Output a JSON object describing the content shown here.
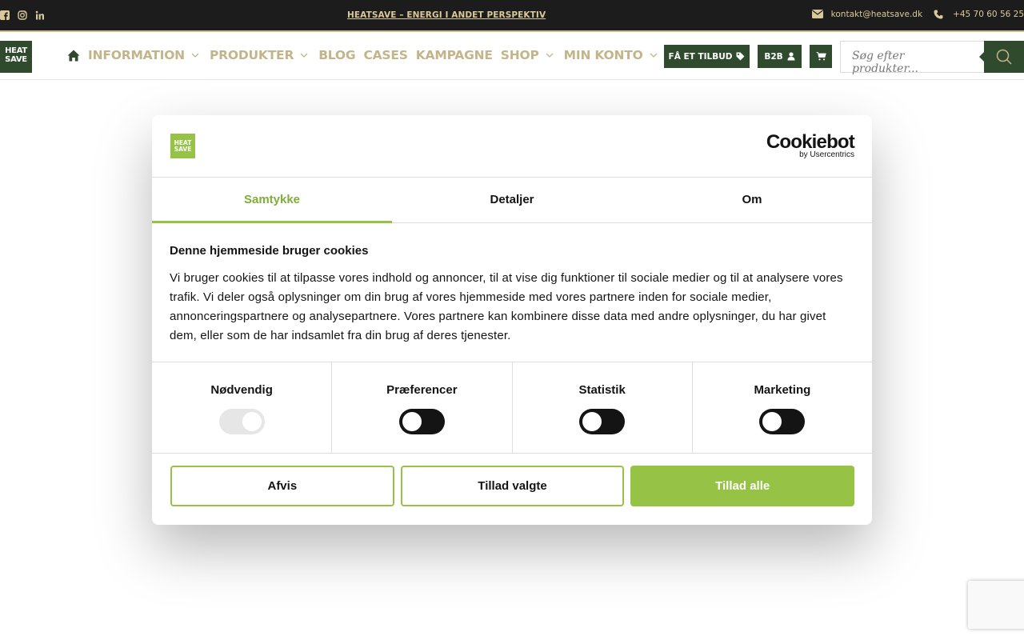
{
  "topbar": {
    "announcement": "HEATSAVE – ENERGI I ANDET PERSPEKTIV",
    "email": "kontakt@heatsave.dk",
    "phone": "+45 70 60 56 25",
    "social_icons": [
      "facebook-icon",
      "instagram-icon",
      "linkedin-icon"
    ]
  },
  "header": {
    "logo_text": "HEAT SAVE",
    "nav": [
      {
        "label": "INFORMATION",
        "dropdown": true
      },
      {
        "label": "PRODUKTER",
        "dropdown": true
      },
      {
        "label": "BLOG",
        "dropdown": false
      },
      {
        "label": "CASES",
        "dropdown": false
      },
      {
        "label": "KAMPAGNE",
        "dropdown": false
      },
      {
        "label": "SHOP",
        "dropdown": true
      },
      {
        "label": "MIN KONTO",
        "dropdown": true
      }
    ],
    "quote_button": "FÅ ET TILBUD",
    "b2b_button": "B2B",
    "search_placeholder": "Søg efter produkter..."
  },
  "cookie_dialog": {
    "brand": "Cookiebot",
    "brand_sub": "by Usercentrics",
    "logo_text": "HEAT SAVE",
    "tabs": [
      "Samtykke",
      "Detaljer",
      "Om"
    ],
    "active_tab": "Samtykke",
    "title": "Denne hjemmeside bruger cookies",
    "text": "Vi bruger cookies til at tilpasse vores indhold og annoncer, til at vise dig funktioner til sociale medier og til at analysere vores trafik. Vi deler også oplysninger om din brug af vores hjemmeside med vores partnere inden for sociale medier, annonceringspartnere og analysepartnere. Vores partnere kan kombinere disse data med andre oplysninger, du har givet dem, eller som de har indsamlet fra din brug af deres tjenester.",
    "toggles": [
      {
        "label": "Nødvendig",
        "checked": true,
        "disabled": true
      },
      {
        "label": "Præferencer",
        "checked": false,
        "disabled": false
      },
      {
        "label": "Statistik",
        "checked": false,
        "disabled": false
      },
      {
        "label": "Marketing",
        "checked": false,
        "disabled": false
      }
    ],
    "buttons": {
      "reject": "Afvis",
      "allow_selected": "Tillad valgte",
      "allow_all": "Tillad alle"
    }
  },
  "colors": {
    "topbar_bg": "#1c1c1c",
    "gold": "#c4b48a",
    "brand_dark_green": "#2f4a2c",
    "cookie_green": "#96c346"
  }
}
